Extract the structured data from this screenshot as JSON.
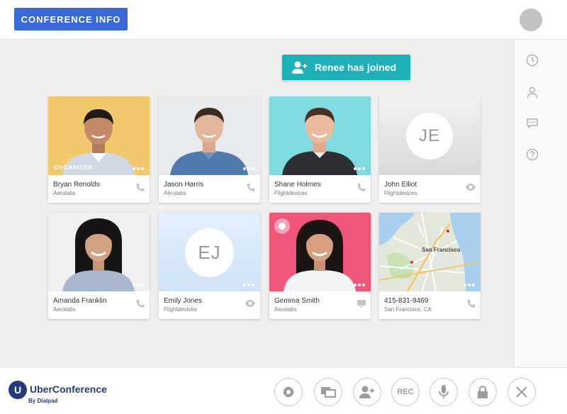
{
  "header": {
    "conference_info_label": "CONFERENCE INFO"
  },
  "notification": {
    "text": "Renee has joined"
  },
  "participants": [
    {
      "name": "Bryan Renolds",
      "org": "Aerolabs",
      "badge": "ORGANIZER",
      "status_icon": "phone-icon",
      "photo_bg": "#f3c96e"
    },
    {
      "name": "Jason Harris",
      "org": "Aerolabs",
      "status_icon": "phone-icon",
      "photo_bg": "#e8ebee"
    },
    {
      "name": "Shane Holmes",
      "org": "Flightdevices",
      "status_icon": "phone-icon",
      "photo_bg": "#7fdbe0"
    },
    {
      "name": "John Elliot",
      "org": "Flightdevices",
      "initials": "JE",
      "status_icon": "eye-icon",
      "photo_bg": "#e6e6e6"
    },
    {
      "name": "Amanda Franklin",
      "org": "Aerolabs",
      "status_icon": "phone-icon",
      "photo_bg": "#f0f0f0"
    },
    {
      "name": "Emily Jones",
      "org": "Flightdevices",
      "initials": "EJ",
      "status_icon": "eye-icon",
      "photo_bg": "#dcecfb"
    },
    {
      "name": "Gemma Smith",
      "org": "Aerolabs",
      "status_icon": "screen-icon",
      "photo_bg": "#f0557a"
    },
    {
      "name": "415-831-9469",
      "org": "San Francisco, CA",
      "status_icon": "phone-icon",
      "photo_bg": "#dfe6d8"
    }
  ],
  "map": {
    "label": "San Francisco"
  },
  "branding": {
    "name": "UberConference",
    "byline": "By Dialpad",
    "mark": "U"
  },
  "controls": [
    {
      "id": "settings",
      "icon": "gear-icon"
    },
    {
      "id": "screenshare",
      "icon": "screen-share-icon"
    },
    {
      "id": "add-participant",
      "icon": "add-user-icon"
    },
    {
      "id": "record",
      "icon": "record-icon",
      "label": "REC"
    },
    {
      "id": "mute",
      "icon": "microphone-icon"
    },
    {
      "id": "lock",
      "icon": "lock-icon"
    },
    {
      "id": "end-call",
      "icon": "close-icon"
    }
  ],
  "sidebar": {
    "icons": [
      "clock-icon",
      "person-icon",
      "chat-icon",
      "help-icon"
    ]
  },
  "colors": {
    "accent_blue": "#3a69d9",
    "teal": "#1fb0b7",
    "navy": "#243a7a",
    "page_bg": "#efefef"
  }
}
